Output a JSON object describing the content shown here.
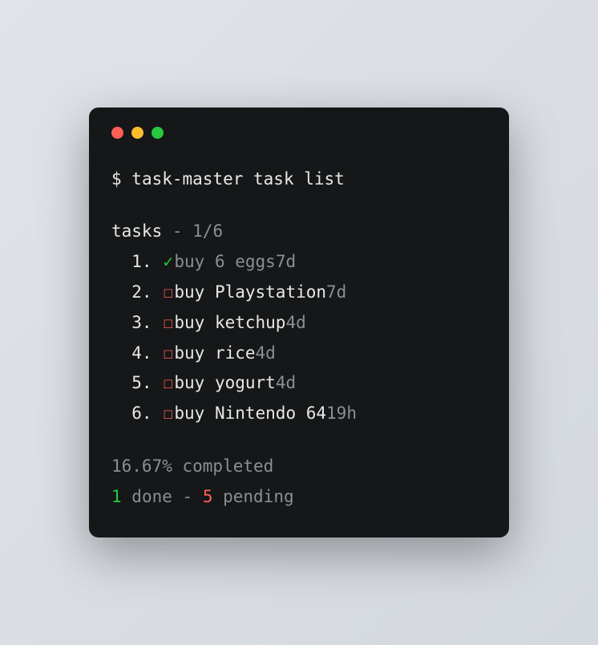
{
  "command": {
    "prompt": "$ ",
    "text": "task-master task list"
  },
  "header": {
    "label": "tasks",
    "sep": " - ",
    "progress": "1/6"
  },
  "tasks": [
    {
      "num": "1",
      "done": true,
      "text": "buy 6 eggs",
      "age": "7d"
    },
    {
      "num": "2",
      "done": false,
      "text": "buy Playstation",
      "age": "7d"
    },
    {
      "num": "3",
      "done": false,
      "text": "buy ketchup",
      "age": "4d"
    },
    {
      "num": "4",
      "done": false,
      "text": "buy rice",
      "age": "4d"
    },
    {
      "num": "5",
      "done": false,
      "text": "buy yogurt",
      "age": "4d"
    },
    {
      "num": "6",
      "done": false,
      "text": "buy Nintendo 64",
      "age": "19h"
    }
  ],
  "summary": {
    "completion": "16.67% completed",
    "done_count": "1",
    "done_label": " done",
    "sep": " - ",
    "pending_count": "5",
    "pending_label": " pending"
  },
  "icons": {
    "check": "✓",
    "checkbox": "☐"
  }
}
